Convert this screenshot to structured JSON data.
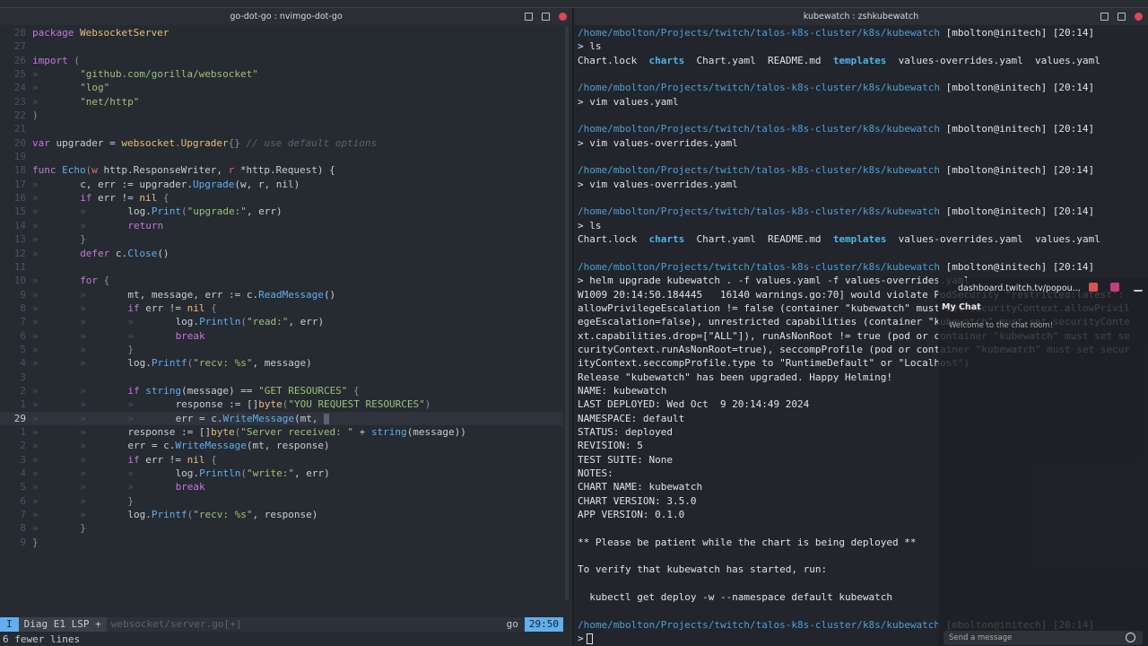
{
  "left_window": {
    "title": "go-dot-go : nvimgo-dot-go"
  },
  "right_window": {
    "title": "kubewatch : zshkubewatch"
  },
  "editor": {
    "lines": [
      {
        "n": "28",
        "i": 0,
        "t": [
          [
            "keyword",
            "package"
          ],
          [
            "plain",
            " "
          ],
          [
            "type",
            "WebsocketServer"
          ]
        ]
      },
      {
        "n": "27",
        "i": 0,
        "t": []
      },
      {
        "n": "26",
        "i": 0,
        "t": [
          [
            "keyword",
            "import"
          ],
          [
            "punct",
            " ("
          ]
        ]
      },
      {
        "n": "25",
        "i": 1,
        "t": [
          [
            "string",
            "\"github.com/gorilla/websocket\""
          ]
        ]
      },
      {
        "n": "24",
        "i": 1,
        "t": [
          [
            "string",
            "\"log\""
          ]
        ]
      },
      {
        "n": "23",
        "i": 1,
        "t": [
          [
            "string",
            "\"net/http\""
          ]
        ]
      },
      {
        "n": "22",
        "i": 0,
        "t": [
          [
            "punct",
            ")"
          ]
        ]
      },
      {
        "n": "21",
        "i": 0,
        "t": []
      },
      {
        "n": "20",
        "i": 0,
        "t": [
          [
            "keyword",
            "var"
          ],
          [
            "plain",
            " upgrader = "
          ],
          [
            "type",
            "websocket"
          ],
          [
            "punct",
            "."
          ],
          [
            "type",
            "Upgrader"
          ],
          [
            "punct",
            "{}"
          ],
          [
            "comment",
            " // use default options"
          ]
        ]
      },
      {
        "n": "19",
        "i": 0,
        "t": []
      },
      {
        "n": "18",
        "i": 0,
        "t": [
          [
            "keyword",
            "func"
          ],
          [
            "plain",
            " "
          ],
          [
            "func",
            "Echo"
          ],
          [
            "punct",
            "("
          ],
          [
            "param",
            "w"
          ],
          [
            "plain",
            " http.ResponseWriter, "
          ],
          [
            "param",
            "r"
          ],
          [
            "plain",
            " *http.Request) {"
          ]
        ]
      },
      {
        "n": "17",
        "i": 1,
        "t": [
          [
            "plain",
            "c, err := upgrader."
          ],
          [
            "func",
            "Upgrade"
          ],
          [
            "plain",
            "(w, r, nil)"
          ]
        ]
      },
      {
        "n": "16",
        "i": 1,
        "t": [
          [
            "keyword",
            "if"
          ],
          [
            "plain",
            " err != "
          ],
          [
            "type",
            "nil"
          ],
          [
            "punct",
            " {"
          ]
        ]
      },
      {
        "n": "15",
        "i": 2,
        "t": [
          [
            "plain",
            "log."
          ],
          [
            "func",
            "Print"
          ],
          [
            "punct",
            "("
          ],
          [
            "string",
            "\"upgrade:\""
          ],
          [
            "plain",
            ", err)"
          ]
        ]
      },
      {
        "n": "14",
        "i": 2,
        "t": [
          [
            "keyword",
            "return"
          ]
        ]
      },
      {
        "n": "13",
        "i": 1,
        "t": [
          [
            "punct",
            "}"
          ]
        ]
      },
      {
        "n": "12",
        "i": 1,
        "t": [
          [
            "keyword",
            "defer"
          ],
          [
            "plain",
            " c."
          ],
          [
            "func",
            "Close"
          ],
          [
            "plain",
            "()"
          ]
        ]
      },
      {
        "n": "11",
        "i": 0,
        "t": []
      },
      {
        "n": "10",
        "i": 1,
        "t": [
          [
            "keyword",
            "for"
          ],
          [
            "punct",
            " {"
          ]
        ]
      },
      {
        "n": "9",
        "i": 2,
        "t": [
          [
            "plain",
            "mt, message, err := c."
          ],
          [
            "func",
            "ReadMessage"
          ],
          [
            "plain",
            "()"
          ]
        ]
      },
      {
        "n": "8",
        "i": 2,
        "t": [
          [
            "keyword",
            "if"
          ],
          [
            "plain",
            " err != "
          ],
          [
            "type",
            "nil"
          ],
          [
            "punct",
            " {"
          ]
        ]
      },
      {
        "n": "7",
        "i": 3,
        "t": [
          [
            "plain",
            "log."
          ],
          [
            "func",
            "Println"
          ],
          [
            "punct",
            "("
          ],
          [
            "string",
            "\"read:\""
          ],
          [
            "plain",
            ", err)"
          ]
        ]
      },
      {
        "n": "6",
        "i": 3,
        "t": [
          [
            "keyword",
            "break"
          ]
        ]
      },
      {
        "n": "5",
        "i": 2,
        "t": [
          [
            "punct",
            "}"
          ]
        ]
      },
      {
        "n": "4",
        "i": 2,
        "t": [
          [
            "plain",
            "log."
          ],
          [
            "func",
            "Printf"
          ],
          [
            "punct",
            "("
          ],
          [
            "string",
            "\"recv: %s\""
          ],
          [
            "plain",
            ", message)"
          ]
        ]
      },
      {
        "n": "3",
        "i": 0,
        "t": []
      },
      {
        "n": "2",
        "i": 2,
        "t": [
          [
            "keyword",
            "if"
          ],
          [
            "plain",
            " "
          ],
          [
            "func",
            "string"
          ],
          [
            "plain",
            "(message) == "
          ],
          [
            "string",
            "\"GET RESOURCES\""
          ],
          [
            "punct",
            " {"
          ]
        ]
      },
      {
        "n": "1",
        "i": 3,
        "t": [
          [
            "plain",
            "response := []"
          ],
          [
            "type",
            "byte"
          ],
          [
            "punct",
            "("
          ],
          [
            "string",
            "\"YOU REQUEST RESOURCES\""
          ],
          [
            "punct",
            ")"
          ]
        ]
      },
      {
        "n": "29",
        "i": 3,
        "cur": true,
        "t": [
          [
            "plain",
            "err = c."
          ],
          [
            "func",
            "WriteMessage"
          ],
          [
            "plain",
            "(mt, "
          ]
        ]
      },
      {
        "n": "1",
        "i": 2,
        "t": [
          [
            "plain",
            "response := []"
          ],
          [
            "type",
            "byte"
          ],
          [
            "punct",
            "("
          ],
          [
            "string",
            "\"Server received: \""
          ],
          [
            "plain",
            " + "
          ],
          [
            "func",
            "string"
          ],
          [
            "plain",
            "(message))"
          ]
        ]
      },
      {
        "n": "2",
        "i": 2,
        "t": [
          [
            "plain",
            "err = c."
          ],
          [
            "func",
            "WriteMessage"
          ],
          [
            "plain",
            "(mt, response)"
          ]
        ]
      },
      {
        "n": "3",
        "i": 2,
        "t": [
          [
            "keyword",
            "if"
          ],
          [
            "plain",
            " err != "
          ],
          [
            "type",
            "nil"
          ],
          [
            "punct",
            " {"
          ]
        ]
      },
      {
        "n": "4",
        "i": 3,
        "t": [
          [
            "plain",
            "log."
          ],
          [
            "func",
            "Println"
          ],
          [
            "punct",
            "("
          ],
          [
            "string",
            "\"write:\""
          ],
          [
            "plain",
            ", err)"
          ]
        ]
      },
      {
        "n": "5",
        "i": 3,
        "t": [
          [
            "keyword",
            "break"
          ]
        ]
      },
      {
        "n": "6",
        "i": 2,
        "t": [
          [
            "punct",
            "}"
          ]
        ]
      },
      {
        "n": "7",
        "i": 2,
        "t": [
          [
            "plain",
            "log."
          ],
          [
            "func",
            "Printf"
          ],
          [
            "punct",
            "("
          ],
          [
            "string",
            "\"recv: %s\""
          ],
          [
            "plain",
            ", response)"
          ]
        ]
      },
      {
        "n": "8",
        "i": 1,
        "t": [
          [
            "punct",
            "}"
          ]
        ]
      },
      {
        "n": "9",
        "i": 0,
        "t": [
          [
            "punct",
            "}"
          ]
        ]
      }
    ],
    "tab_marker": "»",
    "status": {
      "mode": "I",
      "diag": "Diag E1 LSP +",
      "file": "websocket/server.go[+]",
      "filetype": "go",
      "position": "29:50"
    },
    "message": "6 fewer lines"
  },
  "terminal": {
    "lines": [
      [
        [
          "path",
          "/home/mbolton/Projects/twitch/talos-k8s-cluster/k8s/kubewatch"
        ],
        [
          "wh",
          " [mbolton@initech] [20:14]"
        ]
      ],
      [
        [
          "wh",
          "> ls"
        ]
      ],
      [
        [
          "wh",
          "Chart.lock  "
        ],
        [
          "dir",
          "charts"
        ],
        [
          "wh",
          "  Chart.yaml  README.md  "
        ],
        [
          "dir",
          "templates"
        ],
        [
          "wh",
          "  values-overrides.yaml  values.yaml"
        ]
      ],
      [],
      [
        [
          "path",
          "/home/mbolton/Projects/twitch/talos-k8s-cluster/k8s/kubewatch"
        ],
        [
          "wh",
          " [mbolton@initech] [20:14]"
        ]
      ],
      [
        [
          "wh",
          "> vim values.yaml"
        ]
      ],
      [],
      [
        [
          "path",
          "/home/mbolton/Projects/twitch/talos-k8s-cluster/k8s/kubewatch"
        ],
        [
          "wh",
          " [mbolton@initech] [20:14]"
        ]
      ],
      [
        [
          "wh",
          "> vim values-overrides.yaml"
        ]
      ],
      [],
      [
        [
          "path",
          "/home/mbolton/Projects/twitch/talos-k8s-cluster/k8s/kubewatch"
        ],
        [
          "wh",
          " [mbolton@initech] [20:14]"
        ]
      ],
      [
        [
          "wh",
          "> vim values-overrides.yaml"
        ]
      ],
      [],
      [
        [
          "path",
          "/home/mbolton/Projects/twitch/talos-k8s-cluster/k8s/kubewatch"
        ],
        [
          "wh",
          " [mbolton@initech] [20:14]"
        ]
      ],
      [
        [
          "wh",
          "> ls"
        ]
      ],
      [
        [
          "wh",
          "Chart.lock  "
        ],
        [
          "dir",
          "charts"
        ],
        [
          "wh",
          "  Chart.yaml  README.md  "
        ],
        [
          "dir",
          "templates"
        ],
        [
          "wh",
          "  values-overrides.yaml  values.yaml"
        ]
      ],
      [],
      [
        [
          "path",
          "/home/mbolton/Projects/twitch/talos-k8s-cluster/k8s/kubewatch"
        ],
        [
          "wh",
          " [mbolton@initech] [20:14]"
        ]
      ],
      [
        [
          "wh",
          "> helm upgrade kubewatch . -f values.yaml -f values-overrides.yaml"
        ]
      ],
      [
        [
          "wh",
          "W1009 20:14:50.184445   16140 warnings.go:70] would violate PodSecurity \"restricted:latest\":"
        ]
      ],
      [
        [
          "wh",
          "allowPrivilegeEscalation != false (container \"kubewatch\" must set securityContext.allowPrivil"
        ]
      ],
      [
        [
          "wh",
          "egeEscalation=false), unrestricted capabilities (container \"kubewatch\" must set securityConte"
        ]
      ],
      [
        [
          "wh",
          "xt.capabilities.drop=[\"ALL\"]), runAsNonRoot != true (pod or container \"kubewatch\" must set se"
        ]
      ],
      [
        [
          "wh",
          "curityContext.runAsNonRoot=true), seccompProfile (pod or container \"kubewatch\" must set secur"
        ]
      ],
      [
        [
          "wh",
          "ityContext.seccompProfile.type to \"RuntimeDefault\" or \"Localhost\")"
        ]
      ],
      [
        [
          "wh",
          "Release \"kubewatch\" has been upgraded. Happy Helming!"
        ]
      ],
      [
        [
          "wh",
          "NAME: kubewatch"
        ]
      ],
      [
        [
          "wh",
          "LAST DEPLOYED: Wed Oct  9 20:14:49 2024"
        ]
      ],
      [
        [
          "wh",
          "NAMESPACE: default"
        ]
      ],
      [
        [
          "wh",
          "STATUS: deployed"
        ]
      ],
      [
        [
          "wh",
          "REVISION: 5"
        ]
      ],
      [
        [
          "wh",
          "TEST SUITE: None"
        ]
      ],
      [
        [
          "wh",
          "NOTES:"
        ]
      ],
      [
        [
          "wh",
          "CHART NAME: kubewatch"
        ]
      ],
      [
        [
          "wh",
          "CHART VERSION: 3.5.0"
        ]
      ],
      [
        [
          "wh",
          "APP VERSION: 0.1.0"
        ]
      ],
      [],
      [
        [
          "wh",
          "** Please be patient while the chart is being deployed **"
        ]
      ],
      [],
      [
        [
          "wh",
          "To verify that kubewatch has started, run:"
        ]
      ],
      [],
      [
        [
          "wh",
          "  kubectl get deploy -w --namespace default kubewatch"
        ]
      ],
      [],
      [
        [
          "path",
          "/home/mbolton/Projects/twitch/talos-k8s-cluster/k8s/kubewatch"
        ],
        [
          "wh",
          " [mbolton@initech] [20:14]"
        ]
      ],
      [
        [
          "wh",
          ">"
        ]
      ]
    ]
  },
  "chat_overlay": {
    "url": "dashboard.twitch.tv/popou...",
    "title": "My Chat",
    "welcome": "Welcome to the chat room!",
    "input_placeholder": "Send a message"
  }
}
